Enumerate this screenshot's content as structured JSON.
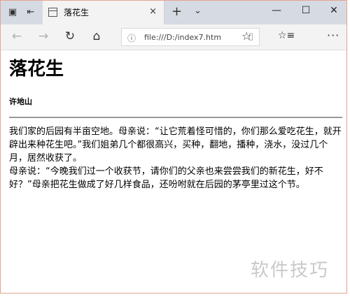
{
  "window": {
    "tab_title": "落花生",
    "tab_close_icon": "×",
    "new_tab_icon": "+",
    "tab_list_icon": "⌄",
    "minimize_icon": "—",
    "maximize_icon": "☐",
    "close_icon": "✕"
  },
  "nav": {
    "back_icon": "←",
    "forward_icon": "→",
    "refresh_icon": "↻",
    "home_icon": "⌂",
    "address": "file:///D:/index7.htm",
    "info_icon": "ⓘ",
    "reading_view_icon": "▯",
    "favorite_icon": "☆",
    "hub_icon": "☆≡",
    "more_icon": "···"
  },
  "page": {
    "title": "落花生",
    "author": "许地山",
    "paragraphs": [
      "我们家的后园有半亩空地。母亲说：“让它荒着怪可惜的，你们那么爱吃花生，就开辟出来种花生吧。”我们姐弟几个都很高兴，买种，翻地，播种，浇水，没过几个月，居然收获了。",
      "母亲说：“今晚我们过一个收获节，请你们的父亲也来尝尝我们的新花生，好不好？”母亲把花生做成了好几样食品，还吩咐就在后园的茅亭里过这个节。"
    ]
  },
  "watermark": "软件技巧"
}
